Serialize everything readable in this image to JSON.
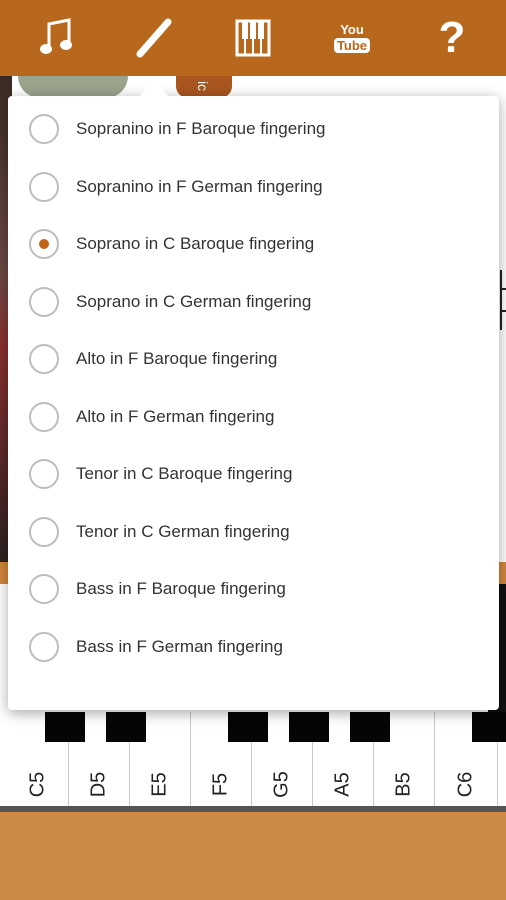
{
  "colors": {
    "toolbar": "#b8681c",
    "accent": "#c2631b",
    "footer": "#cd8a46"
  },
  "toolbar": {
    "icons": [
      {
        "name": "music-note-icon"
      },
      {
        "name": "recorder-flute-icon"
      },
      {
        "name": "piano-keys-icon"
      },
      {
        "name": "youtube-icon",
        "you": "You",
        "tube": "Tube"
      },
      {
        "name": "help-icon",
        "glyph": "?"
      }
    ]
  },
  "background": {
    "tag_text": "ic"
  },
  "popup": {
    "selected_index": 2,
    "options": [
      {
        "label": "Sopranino in F Baroque fingering",
        "checked": false
      },
      {
        "label": "Sopranino in F German fingering",
        "checked": false
      },
      {
        "label": "Soprano in C Baroque fingering",
        "checked": true
      },
      {
        "label": "Soprano in C German fingering",
        "checked": false
      },
      {
        "label": "Alto in F Baroque fingering",
        "checked": false
      },
      {
        "label": "Alto in F German fingering",
        "checked": false
      },
      {
        "label": "Tenor in C Baroque fingering",
        "checked": false
      },
      {
        "label": "Tenor in C German fingering",
        "checked": false
      },
      {
        "label": "Bass in F Baroque fingering",
        "checked": false
      },
      {
        "label": "Bass in F German fingering",
        "checked": false
      }
    ]
  },
  "keyboard": {
    "white_keys": [
      "C5",
      "D5",
      "E5",
      "F5",
      "G5",
      "A5",
      "B5",
      "C6"
    ]
  }
}
